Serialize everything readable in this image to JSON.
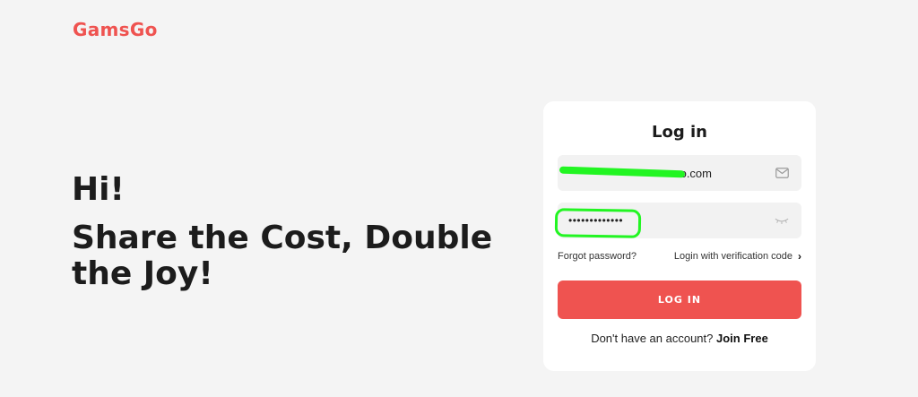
{
  "brand": {
    "name": "GamsGo",
    "color": "#ef5350"
  },
  "hero": {
    "greeting": "Hi!",
    "tagline": "Share the Cost, Double the Joy!"
  },
  "login": {
    "title": "Log in",
    "email_value": "o.com",
    "email_icon": "mail-icon",
    "password_value": "•••••••••••••",
    "password_icon": "eye-closed-icon",
    "forgot_label": "Forgot password?",
    "verify_label": "Login with verification code",
    "verify_chevron": "›",
    "submit_label": "LOG IN",
    "signup_prompt": "Don't have an account?",
    "signup_link": "Join Free"
  },
  "colors": {
    "accent": "#ef5350",
    "background": "#f4f4f4",
    "card": "#ffffff",
    "field": "#f2f2f2",
    "redaction": "#22f522"
  }
}
